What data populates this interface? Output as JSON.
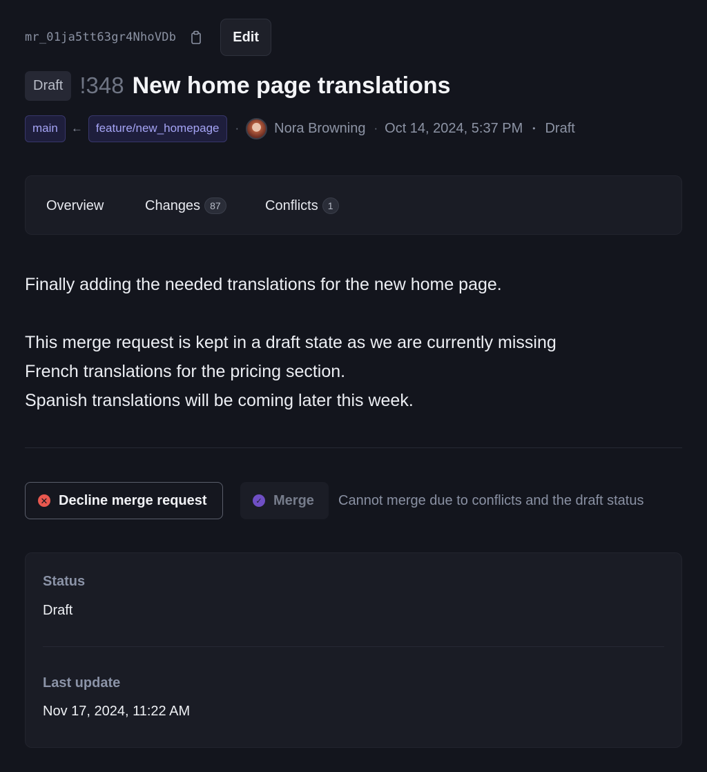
{
  "header": {
    "mr_id": "mr_01ja5tt63gr4NhoVDb",
    "copy_icon": "clipboard-icon",
    "edit_label": "Edit",
    "draft_badge": "Draft",
    "mr_number": "!348",
    "title": "New home page translations"
  },
  "meta": {
    "target_branch": "main",
    "arrow": "←",
    "source_branch": "feature/new_homepage",
    "separator": "·",
    "author": "Nora Browning",
    "date_separator": "·",
    "created": "Oct 14, 2024, 5:37 PM",
    "status_separator": "•",
    "status": "Draft"
  },
  "tabs": [
    {
      "label": "Overview",
      "count": null,
      "active": true
    },
    {
      "label": "Changes",
      "count": "87",
      "active": false
    },
    {
      "label": "Conflicts",
      "count": "1",
      "active": false
    }
  ],
  "description": {
    "line1": "Finally adding the needed translations for the new home page.",
    "line2": "This merge request is kept in a draft state as we are currently missing",
    "line3": "French translations for the pricing section.",
    "line4": "Spanish translations will be coming later this week."
  },
  "actions": {
    "decline_label": "Decline merge request",
    "merge_label": "Merge",
    "merge_note": "Cannot merge due to conflicts and the draft status"
  },
  "details": {
    "status_label": "Status",
    "status_value": "Draft",
    "updated_label": "Last update",
    "updated_value": "Nov 17, 2024, 11:22 AM"
  },
  "colors": {
    "background": "#13151d",
    "card": "#1a1c25",
    "branch_accent": "#a5a4f5",
    "decline_red": "#e8584f",
    "merge_purple": "#6f4fc4"
  }
}
